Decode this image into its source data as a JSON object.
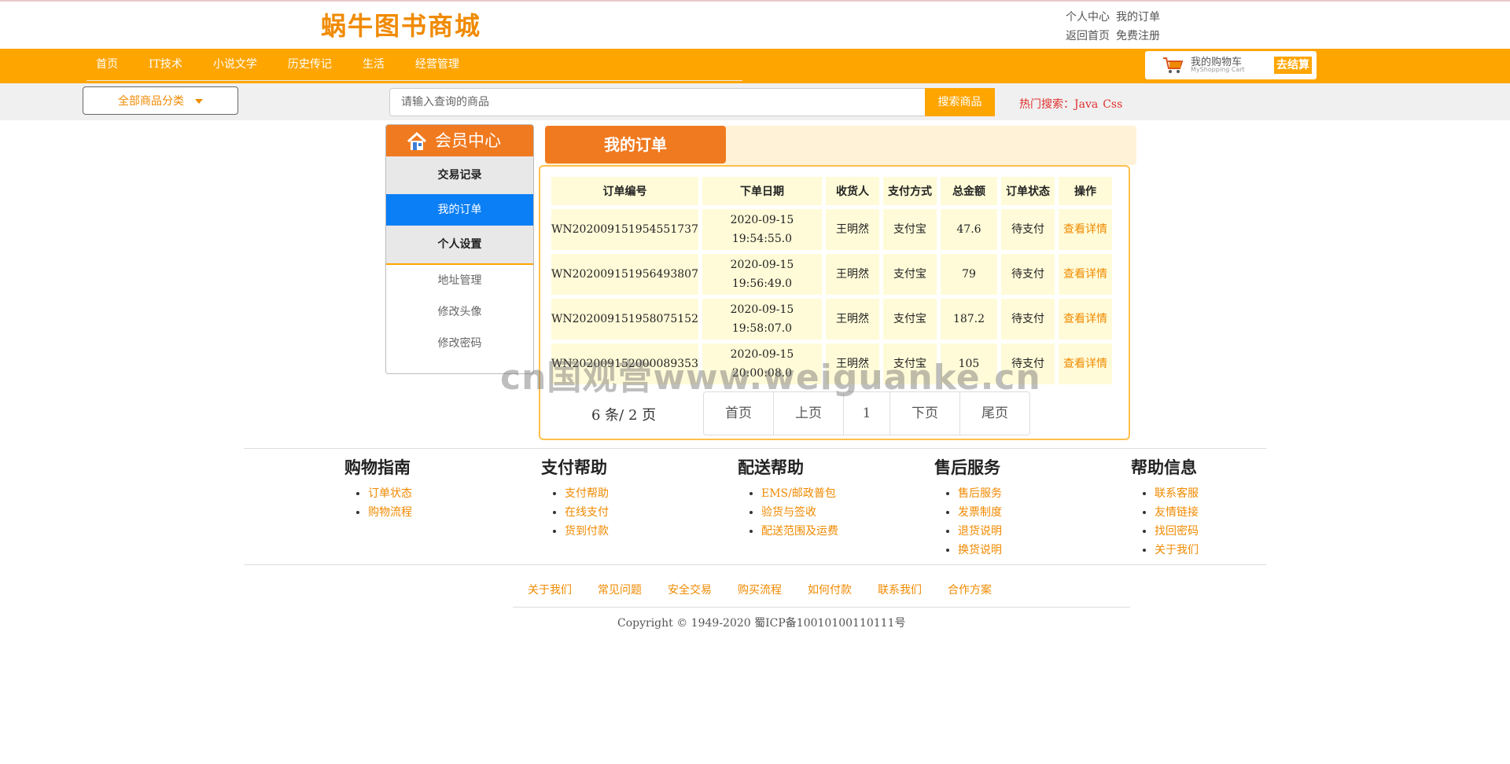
{
  "header": {
    "logo": "蜗牛图书商城",
    "links": [
      "个人中心",
      "我的订单",
      "返回首页",
      "免费注册"
    ]
  },
  "nav": {
    "items": [
      "首页",
      "IT技术",
      "小说文学",
      "历史传记",
      "生活",
      "经营管理"
    ]
  },
  "cart": {
    "title": "我的购物车",
    "subtitle": "MyShopping Cart",
    "checkout": "去结算"
  },
  "search": {
    "category_button": "全部商品分类",
    "placeholder": "请输入查询的商品",
    "button": "搜索商品",
    "hot_label": "热门搜索：",
    "hot_terms": [
      "Java",
      "Css"
    ]
  },
  "sidebar": {
    "title": "会员中心",
    "section1": "交易记录",
    "active_item": "我的订单",
    "section2": "个人设置",
    "items": [
      "地址管理",
      "修改头像",
      "修改密码"
    ]
  },
  "orders": {
    "tab": "我的订单",
    "columns": [
      "订单编号",
      "下单日期",
      "收货人",
      "支付方式",
      "总金额",
      "订单状态",
      "操作"
    ],
    "rows": [
      {
        "id": "WN202009151954551737",
        "date": "2020-09-15",
        "time": "19:54:55.0",
        "receiver": "王明然",
        "payment": "支付宝",
        "total": "47.6",
        "status": "待支付",
        "action": "查看详情"
      },
      {
        "id": "WN202009151956493807",
        "date": "2020-09-15",
        "time": "19:56:49.0",
        "receiver": "王明然",
        "payment": "支付宝",
        "total": "79",
        "status": "待支付",
        "action": "查看详情"
      },
      {
        "id": "WN202009151958075152",
        "date": "2020-09-15",
        "time": "19:58:07.0",
        "receiver": "王明然",
        "payment": "支付宝",
        "total": "187.2",
        "status": "待支付",
        "action": "查看详情"
      },
      {
        "id": "WN202009152000089353",
        "date": "2020-09-15",
        "time": "20:00:08.0",
        "receiver": "王明然",
        "payment": "支付宝",
        "total": "105",
        "status": "待支付",
        "action": "查看详情"
      }
    ],
    "summary": "6 条/ 2 页",
    "pager": [
      "首页",
      "上页",
      "1",
      "下页",
      "尾页"
    ]
  },
  "watermark": "cn国观营www.weiguanke.cn",
  "footer": {
    "columns": [
      {
        "title": "购物指南",
        "items": [
          "订单状态",
          "购物流程"
        ]
      },
      {
        "title": "支付帮助",
        "items": [
          "支付帮助",
          "在线支付",
          "货到付款"
        ]
      },
      {
        "title": "配送帮助",
        "items": [
          "EMS/邮政普包",
          "验货与签收",
          "配送范围及运费"
        ]
      },
      {
        "title": "售后服务",
        "items": [
          "售后服务",
          "发票制度",
          "退货说明",
          "换货说明"
        ]
      },
      {
        "title": "帮助信息",
        "items": [
          "联系客服",
          "友情链接",
          "找回密码",
          "关于我们"
        ]
      }
    ],
    "links": [
      "关于我们",
      "常见问题",
      "安全交易",
      "购买流程",
      "如何付款",
      "联系我们",
      "合作方案"
    ],
    "copyright": "Copyright © 1949-2020 蜀ICP备10010100110111号"
  },
  "colors": {
    "brand_orange": "#ffa500",
    "tab_orange": "#f07a20",
    "active_blue": "#0b7ff5",
    "hot_red": "#e03030"
  }
}
